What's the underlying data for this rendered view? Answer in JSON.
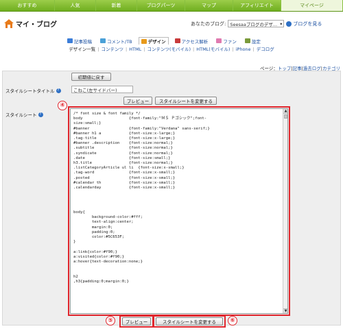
{
  "topnav": {
    "items": [
      "おすすめ",
      "人気",
      "新着",
      "ブログパーツ",
      "マップ",
      "アフィリエイト",
      "マイページ"
    ],
    "active_index": 6
  },
  "header": {
    "logo_text": "マイ・ブログ",
    "blog_label": "あなたのブログ:",
    "blog_select_value": "Seesaaブログのデザ...",
    "view_blog_link": "ブログを見る"
  },
  "function_tabs": [
    {
      "label": "記事投稿",
      "icon": "pencil-icon",
      "color": "#3b7dd8"
    },
    {
      "label": "コメント/TB",
      "icon": "comment-icon",
      "color": "#4aa0d8"
    },
    {
      "label": "デザイン",
      "icon": "design-icon",
      "color": "#e89a1a",
      "active": true
    },
    {
      "label": "アクセス解析",
      "icon": "chart-icon",
      "color": "#c83a3a"
    },
    {
      "label": "ファン",
      "icon": "fan-icon",
      "color": "#e07ab0"
    },
    {
      "label": "設定",
      "icon": "gear-icon",
      "color": "#7a9a3a"
    }
  ],
  "subnav": {
    "items": [
      "デザイン一覧",
      "コンテンツ",
      "HTML",
      "コンテンツ(モバイル)",
      "HTML(モバイル)",
      "iPhone",
      "デコログ"
    ],
    "current_index": 0
  },
  "page_links": {
    "prefix": "ページ：",
    "links": [
      "トップ",
      "記事",
      "過去ログ",
      "カテゴリ"
    ]
  },
  "form": {
    "reset_button": "初期値に戻す",
    "stylesheet_title_label": "スタイルシートタイトル",
    "stylesheet_title_value": "こねこ(左サイドバー)",
    "preview_button": "プレビュー",
    "save_button": "スタイルシートを変更する",
    "stylesheet_label": "スタイルシート",
    "code": "/* font size & font family */\nbody                    {font-family:\"ＭＳ Ｐゴシック\";font-\nsize:small;}\n#banner                 {font-family:\"Verdana\" sans-serif;}\n#banner h1 a            {font-size:x-large;}\n.tag-title              {font-size:x-large;}\n#banner .description    {font-size:normal;}\n.subtitle               {font-size:normal;}\n.syndicate              {font-size:normal;}\n.date                   {font-size:small;}\nh3.title                {font-size:normal;}\n.listCategoryArticle ul li  {font-size:x-small;}\n.tag-word               {font-size:x-small;}\n.posted                 {font-size:x-small;}\n#calendar th            {font-size:x-small;}\n.calendarday            {font-size:x-small;}\n\n\n\n\nbody{\n        background-color:#fff;\n        text-align:center;\n        margin:0;\n        padding:0;\n        color:#5C653F;\n}\n\na:link{color:#f90;}\na:visited{color:#f90;}\na:hover{text-decoration:none;}\n\n\nh2\n,h3{padding:0;margin:0;}"
  },
  "annotations": [
    "④",
    "⑤",
    "⑥"
  ],
  "colors": {
    "nav_green": "#7ab830",
    "link_blue": "#1a4fa0",
    "annotation_red": "#e0262d",
    "logo_orange": "#e87b1a"
  }
}
